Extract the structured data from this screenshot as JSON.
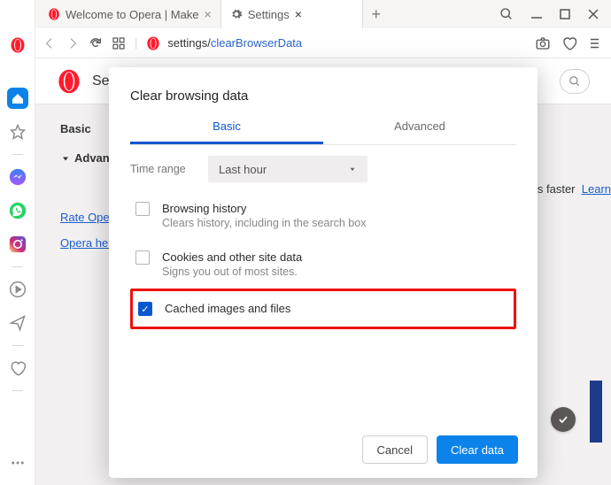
{
  "window": {
    "tabs": [
      {
        "label": "Welcome to Opera | Make"
      },
      {
        "label": "Settings"
      }
    ]
  },
  "address": {
    "host": "settings",
    "path": "clearBrowserData"
  },
  "settings_page": {
    "title": "Settings",
    "left_nav": {
      "basic": "Basic",
      "advanced": "Advanced"
    },
    "links": {
      "rate": "Rate Opera",
      "help": "Opera help"
    },
    "banner_tail": "es faster",
    "banner_link": "Learn"
  },
  "modal": {
    "title": "Clear browsing data",
    "tabs": {
      "basic": "Basic",
      "advanced": "Advanced"
    },
    "range_label": "Time range",
    "range_value": "Last hour",
    "items": [
      {
        "title": "Browsing history",
        "sub": "Clears history, including in the search box",
        "checked": false
      },
      {
        "title": "Cookies and other site data",
        "sub": "Signs you out of most sites.",
        "checked": false
      },
      {
        "title": "Cached images and files",
        "sub": "",
        "checked": true
      }
    ],
    "buttons": {
      "cancel": "Cancel",
      "clear": "Clear data"
    }
  }
}
